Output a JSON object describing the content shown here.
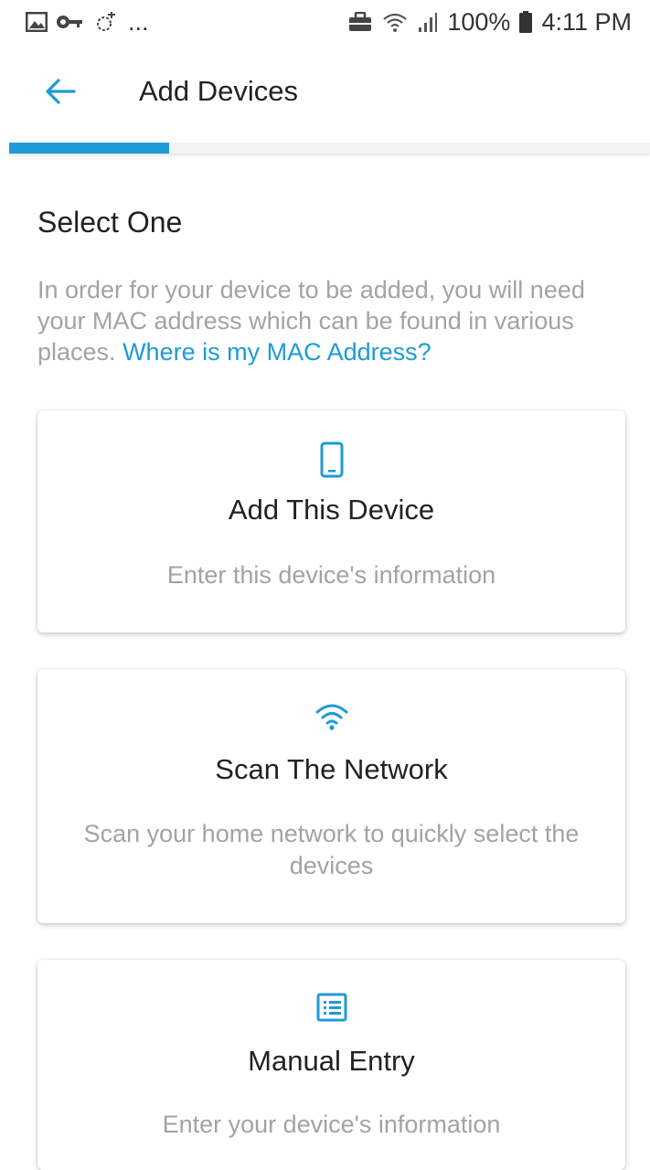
{
  "status_bar": {
    "more_label": "...",
    "battery": "100%",
    "time": "4:11 PM"
  },
  "app_bar": {
    "title": "Add Devices"
  },
  "progress": {
    "fraction": 0.25
  },
  "content": {
    "section_title": "Select One",
    "intro_text": "In order for your device to be added, you will need your MAC address which can be found in various places.",
    "mac_link": "Where is my MAC Address?"
  },
  "cards": [
    {
      "icon": "phone-icon",
      "title": "Add This Device",
      "description": "Enter this device's information"
    },
    {
      "icon": "wifi-icon",
      "title": "Scan The Network",
      "description": "Scan your home network to quickly select the devices"
    },
    {
      "icon": "list-icon",
      "title": "Manual Entry",
      "description": "Enter your device's information"
    }
  ],
  "colors": {
    "accent": "#1e9ad6",
    "muted_text": "#a3a3a3",
    "primary_text": "#222222"
  }
}
